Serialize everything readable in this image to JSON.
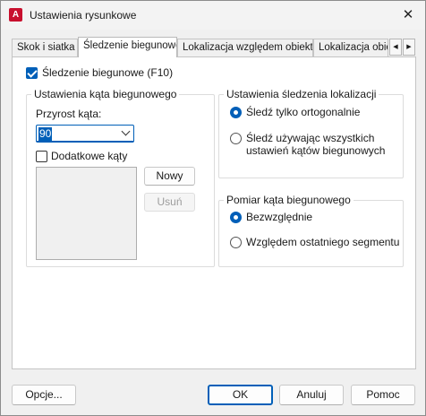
{
  "window": {
    "title": "Ustawienia rysunkowe",
    "app_icon_letter": "A"
  },
  "tabs": [
    {
      "label": "Skok i siatka"
    },
    {
      "label": "Śledzenie biegunowe"
    },
    {
      "label": "Lokalizacja względem obiektu"
    },
    {
      "label": "Lokalizacja obie"
    }
  ],
  "tab_scroll": {
    "left": "◀",
    "right": "▶"
  },
  "polar": {
    "enable_label": "Śledzenie biegunowe (F10)",
    "enabled": true,
    "angle_group": {
      "title": "Ustawienia kąta biegunowego",
      "increment_label": "Przyrost kąta:",
      "increment_value": "90",
      "additional_label": "Dodatkowe kąty",
      "additional_checked": false,
      "new_button": "Nowy",
      "delete_button": "Usuń"
    },
    "tracking_group": {
      "title": "Ustawienia śledzenia lokalizacji",
      "options": [
        {
          "label": "Śledź tylko ortogonalnie",
          "selected": true
        },
        {
          "label_line1": "Śledź używając wszystkich",
          "label_line2": "ustawień kątów biegunowych",
          "selected": false
        }
      ]
    },
    "measure_group": {
      "title": "Pomiar kąta biegunowego",
      "options": [
        {
          "label": "Bezwzględnie",
          "selected": true
        },
        {
          "label": "Względem ostatniego segmentu",
          "selected": false
        }
      ]
    }
  },
  "footer": {
    "options_button": "Opcje...",
    "ok_button": "OK",
    "cancel_button": "Anuluj",
    "help_button": "Pomoc"
  },
  "colors": {
    "accent": "#005fb8",
    "app_icon": "#c8102e"
  }
}
